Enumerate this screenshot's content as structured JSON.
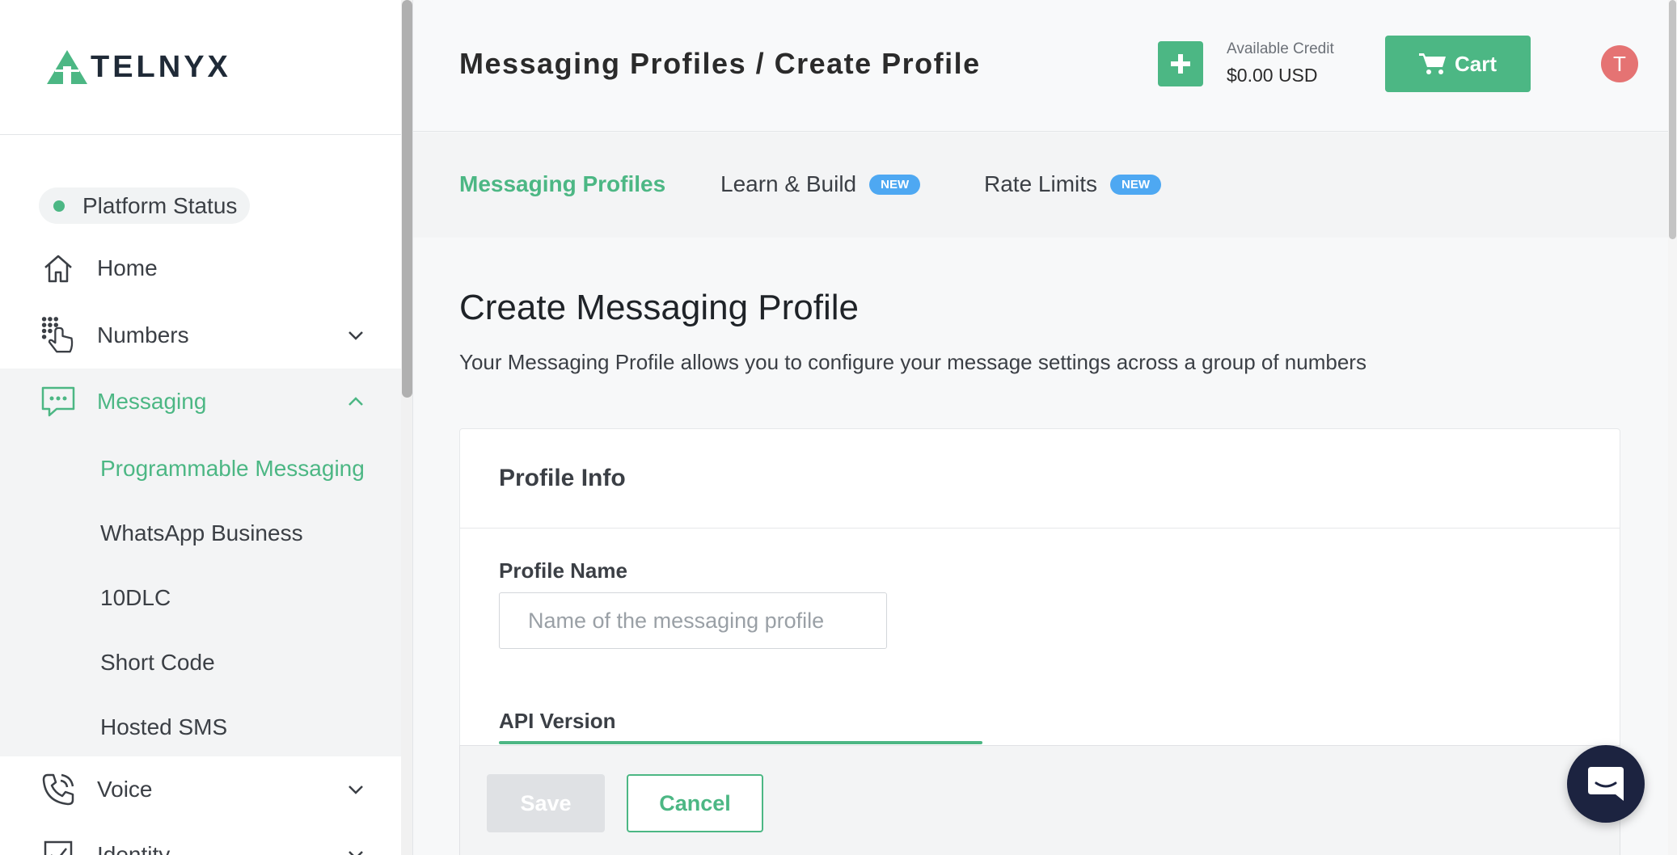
{
  "brand": {
    "name": "TELNYX",
    "accent": "#4cb784"
  },
  "sidebar": {
    "platform_status": "Platform Status",
    "items": [
      {
        "label": "Home",
        "icon": "home-icon"
      },
      {
        "label": "Numbers",
        "icon": "dialpad-icon"
      },
      {
        "label": "Messaging",
        "icon": "chat-bubble-icon"
      },
      {
        "label": "Voice",
        "icon": "phone-icon"
      },
      {
        "label": "Identity",
        "icon": "checkbox-icon"
      }
    ],
    "messaging_sub": [
      {
        "label": "Programmable Messaging"
      },
      {
        "label": "WhatsApp Business"
      },
      {
        "label": "10DLC"
      },
      {
        "label": "Short Code"
      },
      {
        "label": "Hosted SMS"
      }
    ]
  },
  "header": {
    "title": "Messaging Profiles / Create Profile",
    "credit_label": "Available Credit",
    "credit_value": "$0.00 USD",
    "cart_label": "Cart",
    "avatar_initial": "T"
  },
  "tabs": [
    {
      "label": "Messaging Profiles"
    },
    {
      "label": "Learn & Build",
      "badge": "NEW"
    },
    {
      "label": "Rate Limits",
      "badge": "NEW"
    }
  ],
  "main": {
    "heading": "Create Messaging Profile",
    "description": "Your Messaging Profile allows you to configure your message settings across a group of numbers",
    "card_title": "Profile Info",
    "profile_name_label": "Profile Name",
    "profile_name_placeholder": "Name of the messaging profile",
    "api_version_label": "API Version"
  },
  "actions": {
    "save": "Save",
    "cancel": "Cancel"
  }
}
